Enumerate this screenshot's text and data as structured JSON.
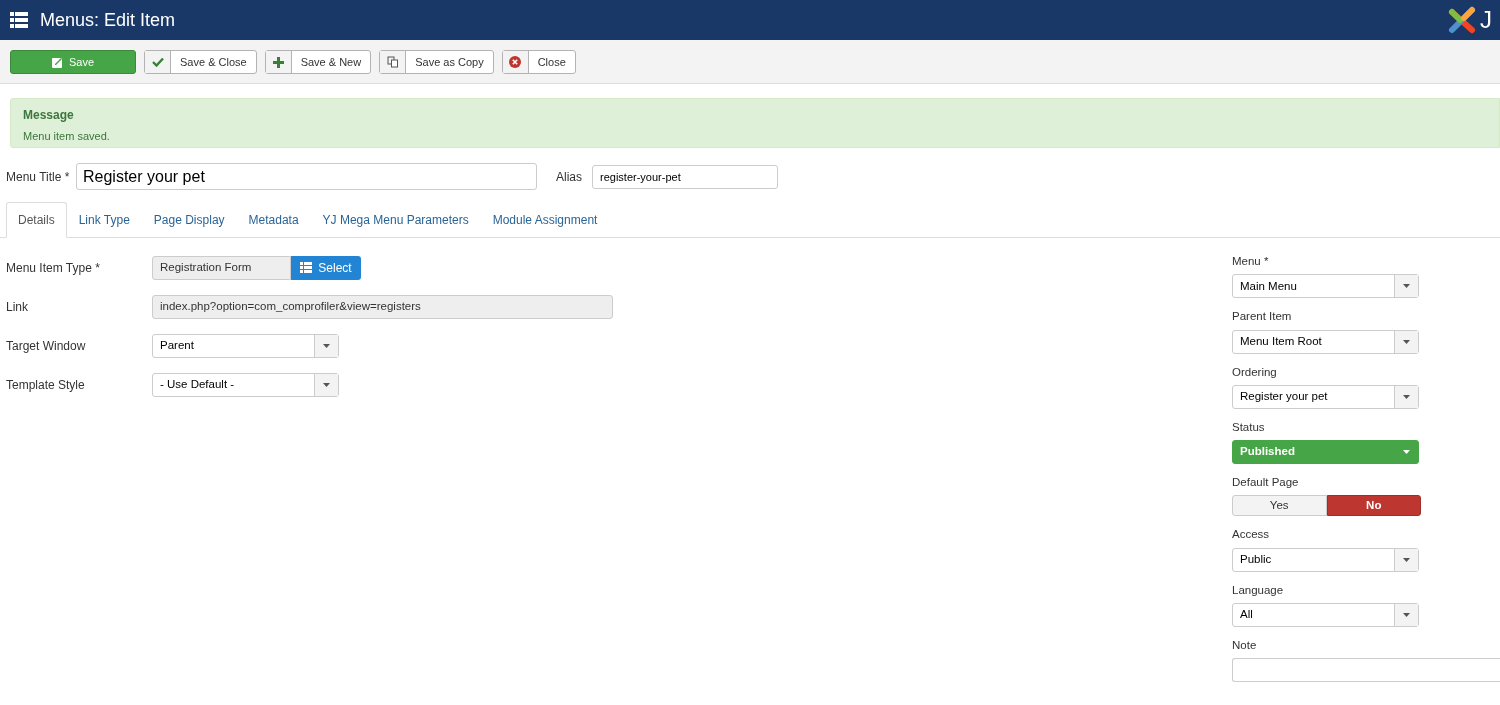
{
  "header": {
    "title": "Menus: Edit Item",
    "logo_text": "J"
  },
  "toolbar": [
    {
      "label": "Save",
      "kind": "save"
    },
    {
      "label": "Save & Close",
      "kind": "save-close"
    },
    {
      "label": "Save & New",
      "kind": "save-new"
    },
    {
      "label": "Save as Copy",
      "kind": "save-copy"
    },
    {
      "label": "Close",
      "kind": "close"
    }
  ],
  "message": {
    "heading": "Message",
    "text": "Menu item saved."
  },
  "title_row": {
    "title_label": "Menu Title *",
    "title_value": "Register your pet",
    "alias_label": "Alias",
    "alias_value": "register-your-pet"
  },
  "tabs": [
    {
      "label": "Details",
      "selected": true
    },
    {
      "label": "Link Type",
      "selected": false
    },
    {
      "label": "Page Display",
      "selected": false
    },
    {
      "label": "Metadata",
      "selected": false
    },
    {
      "label": "YJ Mega Menu Parameters",
      "selected": false
    },
    {
      "label": "Module Assignment",
      "selected": false
    }
  ],
  "left_fields": [
    {
      "label": "Menu Item Type *",
      "kind": "type",
      "value": "Registration Form",
      "button": "Select"
    },
    {
      "label": "Link",
      "kind": "readonly",
      "value": "index.php?option=com_comprofiler&view=registers"
    },
    {
      "label": "Target Window",
      "kind": "select",
      "value": "Parent"
    },
    {
      "label": "Template Style",
      "kind": "select",
      "value": "- Use Default -"
    }
  ],
  "right_fields": [
    {
      "label": "Menu *",
      "kind": "select",
      "value": "Main Menu"
    },
    {
      "label": "Parent Item",
      "kind": "select",
      "value": "Menu Item Root"
    },
    {
      "label": "Ordering",
      "kind": "select",
      "value": "Register your pet"
    },
    {
      "label": "Status",
      "kind": "status",
      "value": "Published"
    },
    {
      "label": "Default Page",
      "kind": "toggle",
      "options": [
        {
          "label": "Yes",
          "selected": false
        },
        {
          "label": "No",
          "selected": true
        }
      ]
    },
    {
      "label": "Access",
      "kind": "select",
      "value": "Public"
    },
    {
      "label": "Language",
      "kind": "select",
      "value": "All"
    },
    {
      "label": "Note",
      "kind": "text"
    }
  ]
}
